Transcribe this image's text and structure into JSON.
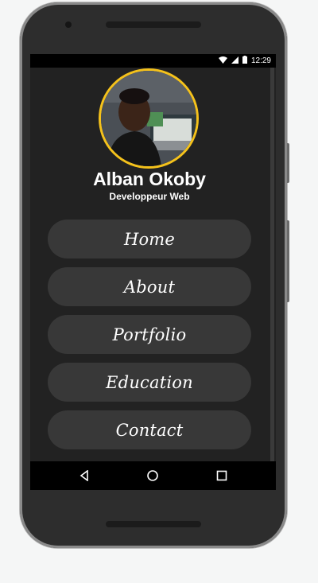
{
  "statusbar": {
    "time": "12:29",
    "icons": [
      "wifi-icon",
      "signal-icon",
      "battery-icon"
    ]
  },
  "profile": {
    "name": "Alban Okoby",
    "role": "Developpeur Web",
    "avatar_border_color": "#f5c21b"
  },
  "menu": {
    "items": [
      {
        "label": "Home"
      },
      {
        "label": "About"
      },
      {
        "label": "Portfolio"
      },
      {
        "label": "Education"
      },
      {
        "label": "Contact"
      }
    ]
  },
  "navbar": {
    "icons": [
      "back-icon",
      "home-circle-icon",
      "recents-icon"
    ]
  },
  "colors": {
    "background": "#222222",
    "button": "#383838",
    "text": "#ffffff"
  }
}
